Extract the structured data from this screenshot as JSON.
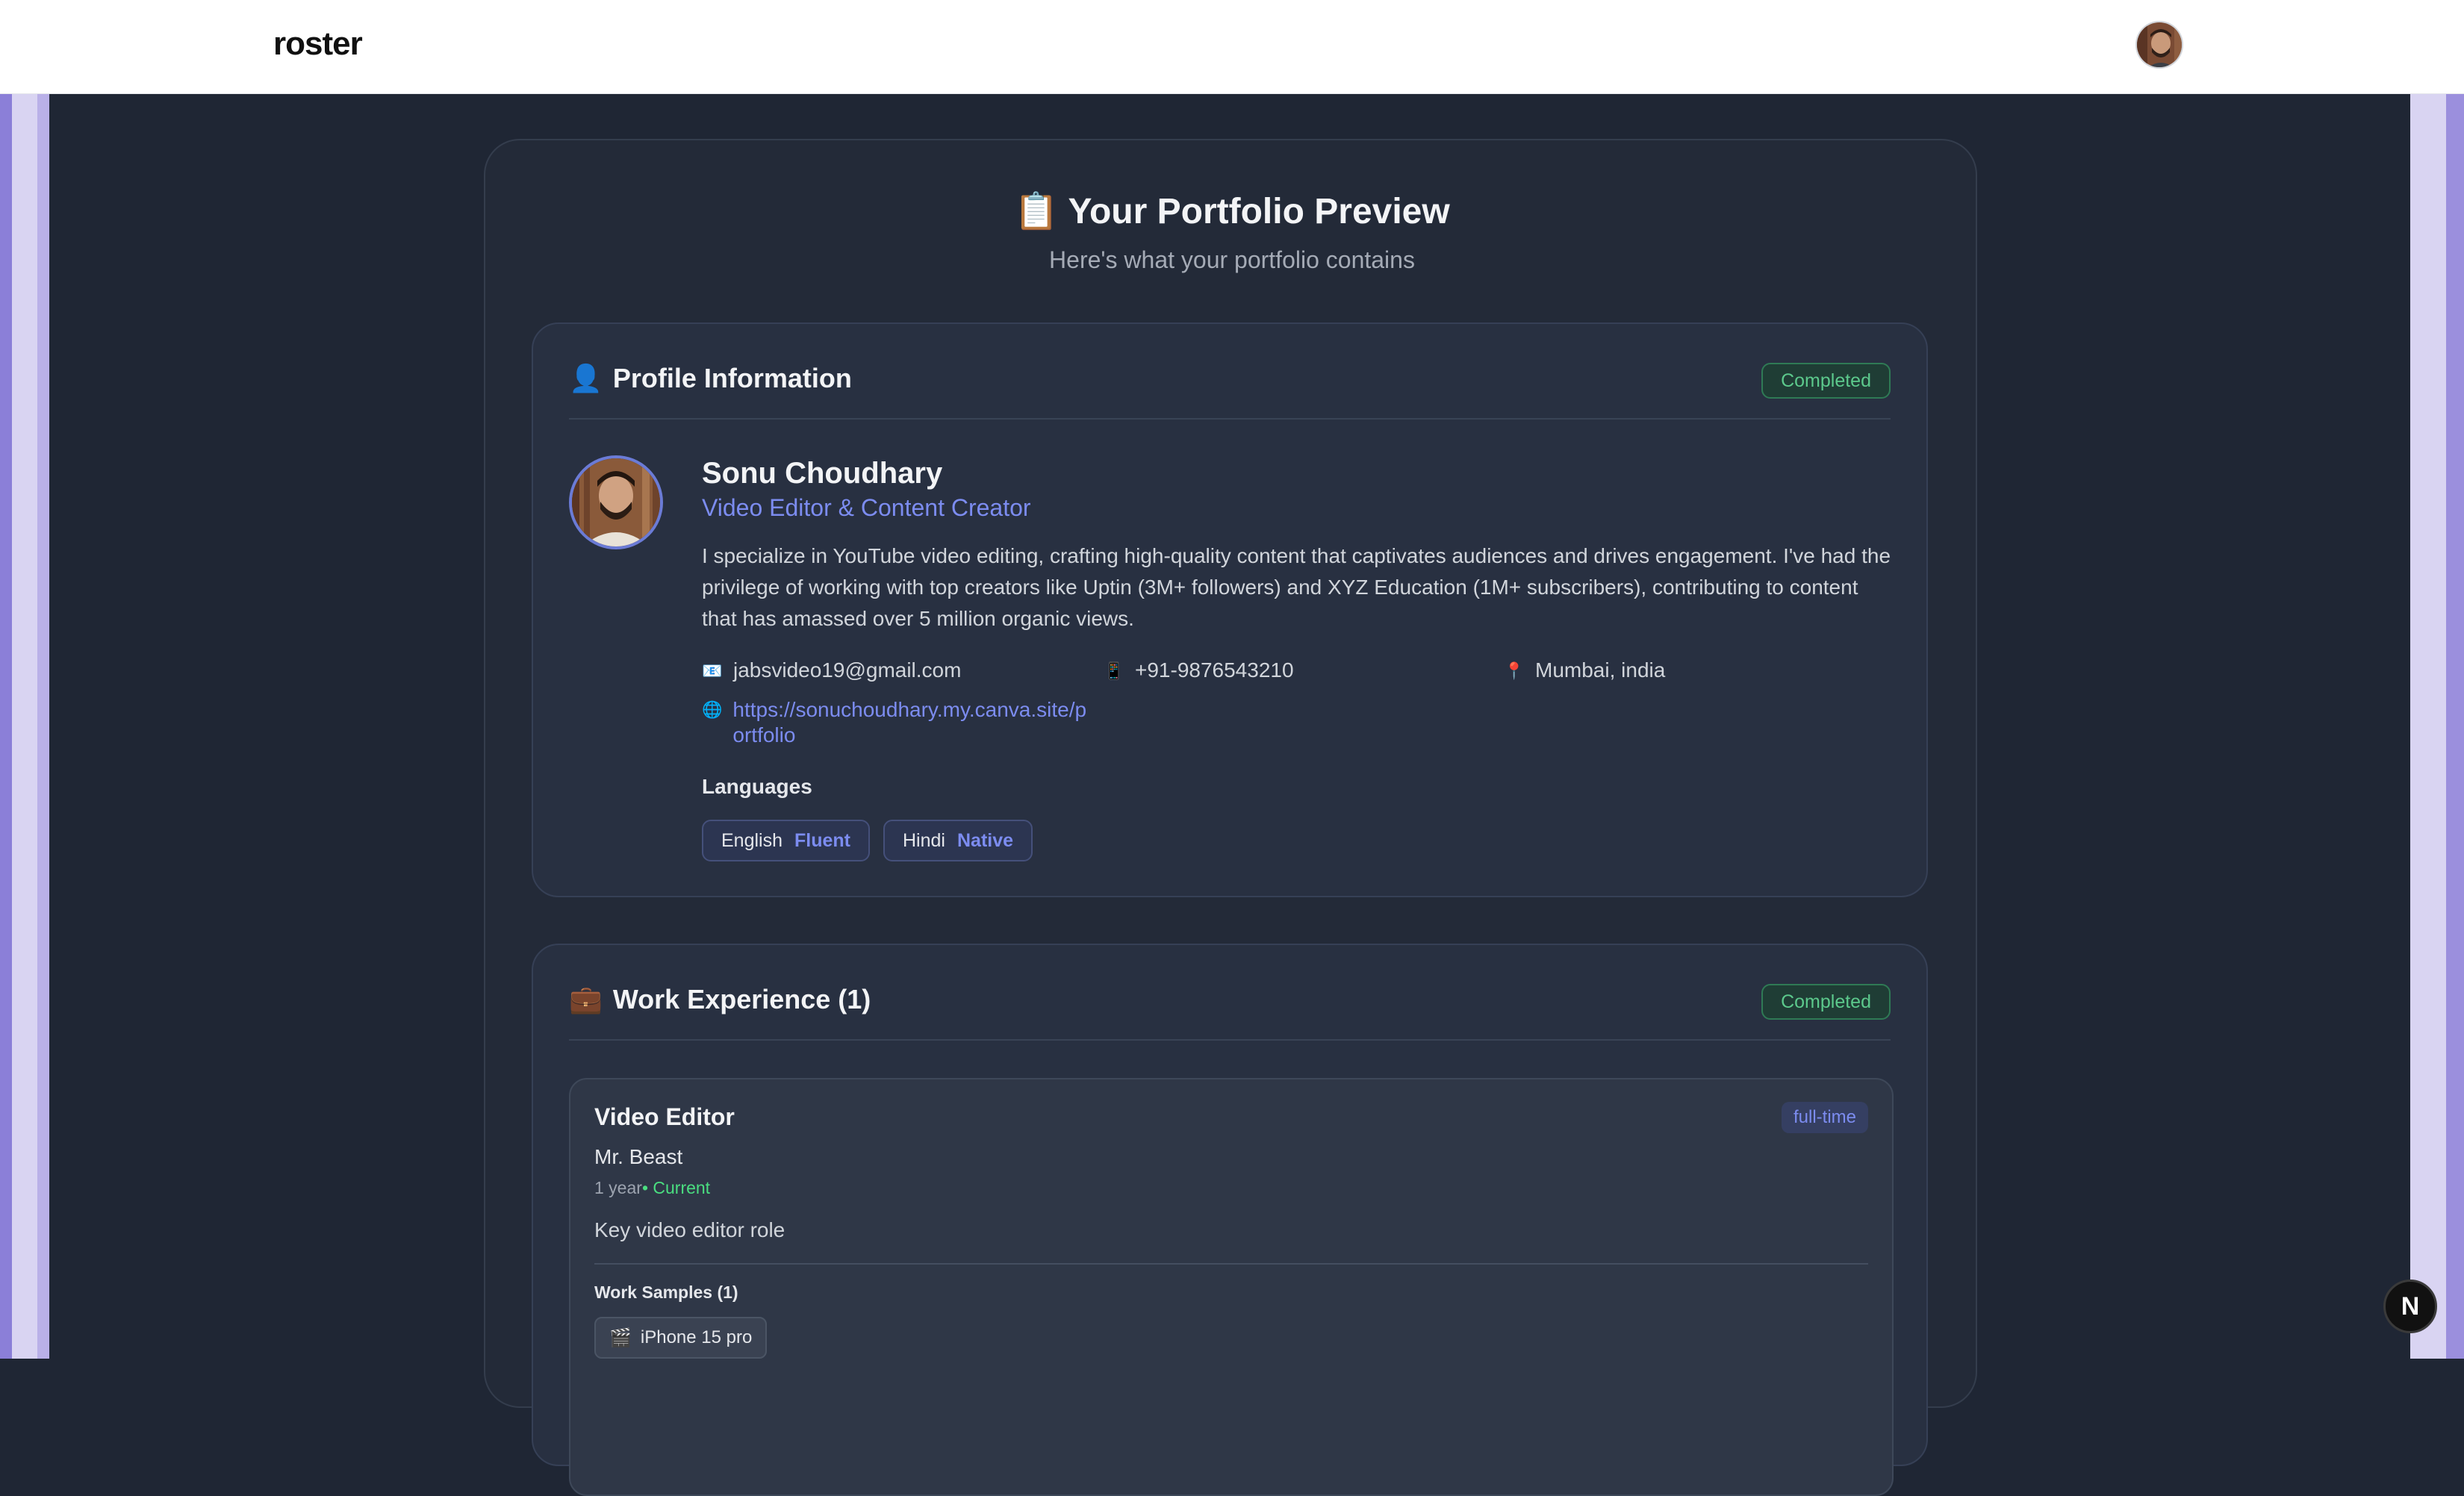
{
  "header": {
    "brand": "roster",
    "avatar_icon": "user-avatar"
  },
  "preview": {
    "icon": "📋",
    "title": "Your Portfolio Preview",
    "subtitle": "Here's what your portfolio contains"
  },
  "profile_section": {
    "icon": "👤",
    "title": "Profile Information",
    "status": "Completed",
    "name": "Sonu Choudhary",
    "role": "Video Editor & Content Creator",
    "bio": "I specialize in YouTube video editing, crafting high-quality content that captivates audiences and drives engagement. I've had the privilege of working with top creators like Uptin (3M+ followers) and XYZ Education (1M+ subscribers), contributing to content that has amassed over 5 million organic views.",
    "email_icon": "📧",
    "email": "jabsvideo19@gmail.com",
    "phone_icon": "📱",
    "phone": "+91-9876543210",
    "location_icon": "📍",
    "location": "Mumbai, india",
    "website_icon": "🌐",
    "website": "https://sonuchoudhary.my.canva.site/portfolio",
    "languages_title": "Languages",
    "languages": [
      {
        "name": "English",
        "level": "Fluent"
      },
      {
        "name": "Hindi",
        "level": "Native"
      }
    ]
  },
  "work_section": {
    "icon": "💼",
    "title": "Work Experience (1)",
    "status": "Completed",
    "jobs": [
      {
        "title": "Video Editor",
        "type": "full-time",
        "company": "Mr. Beast",
        "duration": "1 year",
        "current": "• Current",
        "description": "Key video editor role",
        "samples_title": "Work Samples (1)",
        "sample_icon": "🎬",
        "sample": "iPhone 15 pro"
      }
    ]
  },
  "dev_badge": "N",
  "colors": {
    "accent": "#7c8cf0",
    "success": "#5cc98c",
    "background": "#1f2634",
    "card": "#283041"
  }
}
